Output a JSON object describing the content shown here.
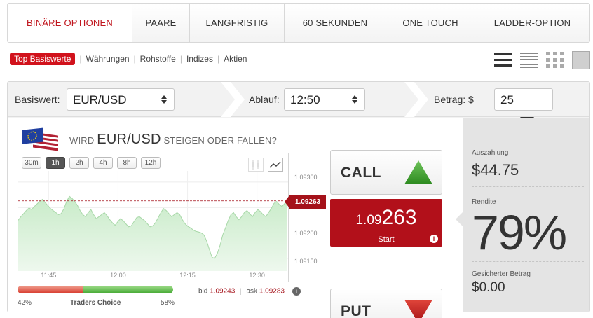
{
  "tabs": [
    "BINÄRE OPTIONEN",
    "PAARE",
    "LANGFRISTIG",
    "60 SEKUNDEN",
    "ONE TOUCH",
    "LADDER-OPTION"
  ],
  "filters": [
    "Top Basiswerte",
    "Währungen",
    "Rohstoffe",
    "Indizes",
    "Aktien"
  ],
  "controls": {
    "asset_label": "Basiswert:",
    "asset_value": "EUR/USD",
    "expiry_label": "Ablauf:",
    "expiry_value": "12:50",
    "amount_label": "Betrag: $",
    "amount_value": "25"
  },
  "question": {
    "prefix": "WIRD",
    "pair": "EUR/USD",
    "suffix": "STEIGEN ODER FALLEN?"
  },
  "timeframes": [
    "30m",
    "1h",
    "2h",
    "4h",
    "8h",
    "12h"
  ],
  "active_timeframe": "1h",
  "chart_data": {
    "type": "area",
    "x_ticks": [
      "11:45",
      "12:00",
      "12:15",
      "12:30"
    ],
    "y_ticks": [
      "1.09300",
      "1.09200",
      "1.09150"
    ],
    "current_price_label": "1.09263",
    "current_price": 1.09263,
    "series": [
      {
        "values": [
          1.09225,
          1.09232,
          1.09238,
          1.09244,
          1.09249,
          1.09246,
          1.09252,
          1.09257,
          1.09262,
          1.09266,
          1.0926,
          1.09254,
          1.09248,
          1.09244,
          1.0924,
          1.09236,
          1.09238,
          1.09248,
          1.09262,
          1.09272,
          1.09268,
          1.09262,
          1.09254,
          1.09244,
          1.09236,
          1.09232,
          1.0924,
          1.09246,
          1.09236,
          1.09228,
          1.09232,
          1.09236,
          1.0924,
          1.09234,
          1.09226,
          1.0922,
          1.09215,
          1.09222,
          1.09228,
          1.09224,
          1.09218,
          1.09212,
          1.09214,
          1.09222,
          1.0923,
          1.09232,
          1.09228,
          1.09224,
          1.09218,
          1.09212,
          1.09214,
          1.0922,
          1.0923,
          1.0924,
          1.09248,
          1.09244,
          1.09238,
          1.09232,
          1.09236,
          1.0924,
          1.09236,
          1.09226,
          1.09218,
          1.09213,
          1.0921,
          1.09206,
          1.09203,
          1.09202,
          1.092,
          1.09196,
          1.09184,
          1.09168,
          1.09152,
          1.0915,
          1.0916,
          1.09176,
          1.09196,
          1.0921,
          1.09224,
          1.09236,
          1.0924,
          1.09232,
          1.09226,
          1.09232,
          1.0924,
          1.09244,
          1.09238,
          1.09232,
          1.0924,
          1.09246,
          1.09242,
          1.09236,
          1.09232,
          1.0924,
          1.09248,
          1.09258,
          1.09262,
          1.09256,
          1.09252,
          1.09258,
          1.09263
        ]
      }
    ]
  },
  "sentiment": {
    "sell_pct": 42,
    "buy_pct": 58,
    "sell_label": "42%",
    "buy_label": "58%",
    "title": "Traders Choice"
  },
  "quote": {
    "bid_label": "bid",
    "bid_value": "1.09243",
    "ask_label": "ask",
    "ask_value": "1.09283"
  },
  "call_label": "CALL",
  "put_label": "PUT",
  "start_price": {
    "prefix": "1.09",
    "big": "263",
    "label": "Start"
  },
  "payout": {
    "label": "Auszahlung",
    "value": "$44.75"
  },
  "return": {
    "label": "Rendite",
    "value": "79%"
  },
  "secured": {
    "label": "Gesicherter Betrag",
    "value": "$0.00"
  },
  "colors": {
    "accent_red": "#c0171f",
    "call_green": "#3a9a2a",
    "put_red": "#c4181e",
    "chart_fill": "#d6efd6",
    "chart_line": "#a8d8a8"
  }
}
